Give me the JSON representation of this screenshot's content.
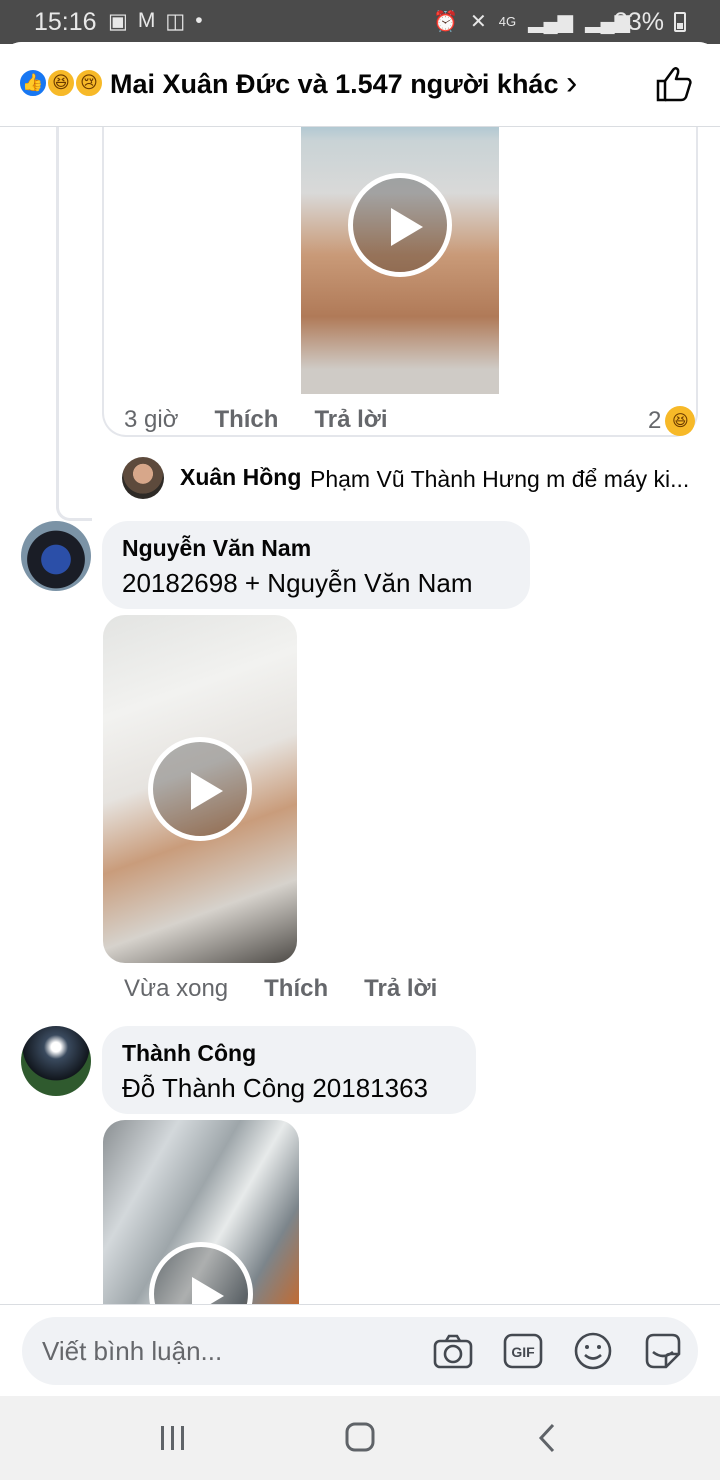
{
  "status_bar": {
    "time": "15:16",
    "left_icons": [
      "teams-icon",
      "gmail-icon",
      "office-icon",
      "dot-icon"
    ],
    "right_icons": [
      "alarm-icon",
      "mute-icon",
      "4g-icon",
      "signal-icon",
      "signal-icon"
    ],
    "battery": "33%"
  },
  "header": {
    "title": "Mai Xuân Đức và 1.547 người khác",
    "reactions": [
      "like",
      "haha",
      "sad"
    ]
  },
  "comments": [
    {
      "time": "3 giờ",
      "like_label": "Thích",
      "reply_label": "Trả lời",
      "reaction_count": "2",
      "reply_preview": {
        "name": "Xuân Hồng",
        "text": "Phạm Vũ Thành Hưng m để máy ki..."
      }
    },
    {
      "name": "Nguyễn Văn Nam",
      "text": "20182698 + Nguyễn Văn Nam",
      "time": "Vừa xong",
      "like_label": "Thích",
      "reply_label": "Trả lời"
    },
    {
      "name": "Thành Công",
      "text": "Đỗ Thành Công 20181363"
    }
  ],
  "composer": {
    "placeholder": "Viết bình luận...",
    "icons": [
      "camera-icon",
      "gif-icon",
      "emoji-icon",
      "sticker-icon"
    ]
  },
  "nav": [
    "recents-button",
    "home-button",
    "back-button"
  ]
}
